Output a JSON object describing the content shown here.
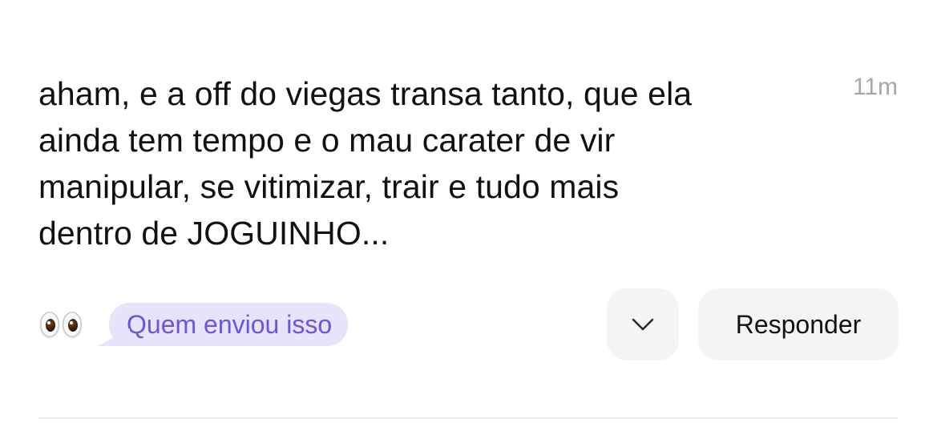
{
  "message": {
    "lines": [
      "aham, e a off do viegas transa tanto, que ela",
      "ainda tem tempo e o mau carater de vir",
      "manipular, se vitimizar, trair e tudo mais",
      "dentro de JOGUINHO..."
    ],
    "timestamp": "11m"
  },
  "reaction": {
    "emoji_icon": "eyes-emoji-icon",
    "who_sent_label": "Quem enviou isso",
    "bubble_color": "#e7e3fb",
    "text_color": "#6c55de"
  },
  "actions": {
    "expand_icon": "chevron-down-icon",
    "reply_label": "Responder",
    "button_bg": "#f4f4f6"
  }
}
